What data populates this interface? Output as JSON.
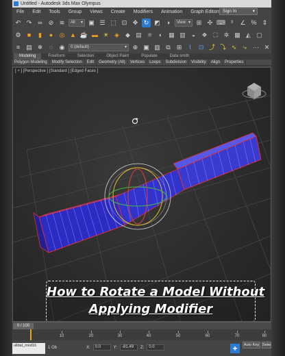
{
  "window": {
    "title": "Untitled - Autodesk 3ds Max Olympus"
  },
  "menu": {
    "items": [
      "File",
      "Edit",
      "Tools",
      "Group",
      "Views",
      "Create",
      "Modifiers",
      "Animation",
      "Graph Editors",
      "»"
    ],
    "sign_in": "Sign In"
  },
  "toolbar": {
    "selection_filter": "All",
    "view_dropdown": "View",
    "layer_dropdown": "0 (default)"
  },
  "ribbon": {
    "tabs": [
      "Modeling",
      "Freeform",
      "Selection",
      "Object Paint",
      "Populate",
      "Data smith"
    ],
    "active_tab": "Modeling",
    "subtabs": [
      "Polygon Modeling",
      "Modify Selection",
      "Edit",
      "Geometry (All)",
      "Vertices",
      "Loops",
      "Subdivision",
      "Visibility",
      "Align",
      "Properties"
    ]
  },
  "viewport": {
    "label": "[ + ] [Perspective ] [Standard ] [Edged Faces ]",
    "filter_icon": "funnel-icon"
  },
  "caption": {
    "line1": "How to Rotate a Model Without",
    "line2": "Applying Modifier"
  },
  "timeline": {
    "frame_counter": "0 / 100",
    "ticks": [
      "10",
      "20",
      "30",
      "40",
      "50",
      "60",
      "70",
      "80"
    ]
  },
  "status": {
    "script_listener": "ulldat_mod16",
    "selection_text": "1 Ob",
    "x_label": "X:",
    "x_value": "0.0",
    "y_label": "Y:",
    "y_value": "-81.49",
    "z_label": "Z:",
    "z_value": "0.0",
    "auto_key": "Auto Key",
    "set_key": "Selec"
  },
  "colors": {
    "accent": "#2b7bd1",
    "model_fill": "#3030c8",
    "model_edges": "#8080ff",
    "selection_outline": "#e03030",
    "caption_text": "#ffffff"
  }
}
